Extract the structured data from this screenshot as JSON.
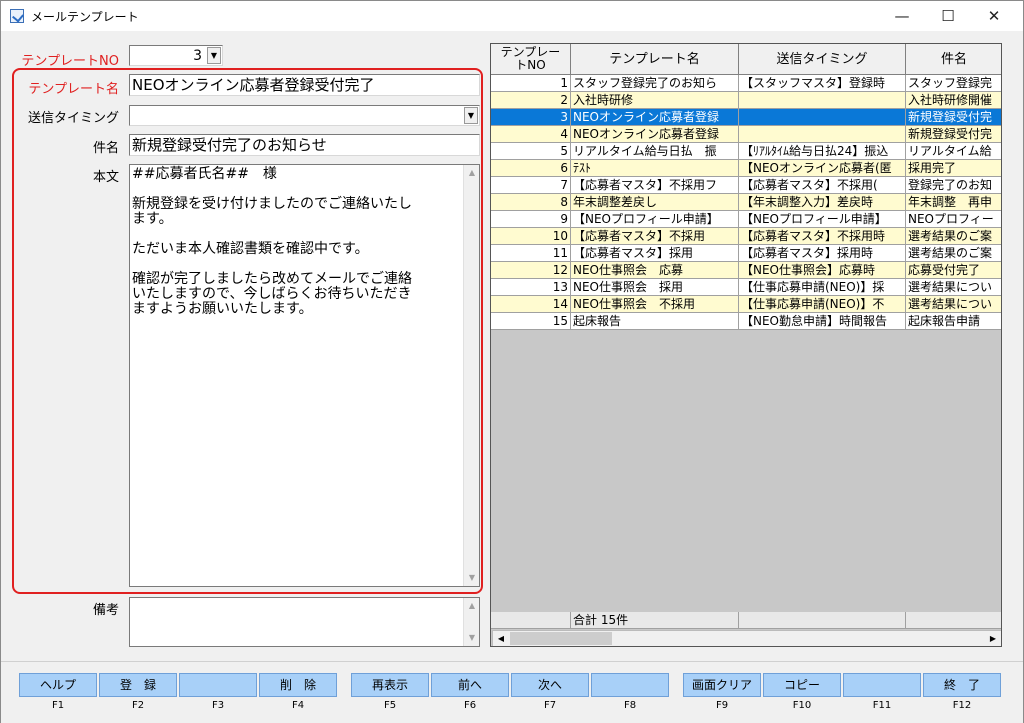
{
  "window": {
    "title": "メールテンプレート",
    "minimize": "—",
    "maximize": "☐",
    "close": "✕"
  },
  "form": {
    "template_no_label": "テンプレートNO",
    "template_no_value": "3",
    "template_name_label": "テンプレート名",
    "template_name_value": "NEOオンライン応募者登録受付完了",
    "timing_label": "送信タイミング",
    "timing_value": "",
    "subject_label": "件名",
    "subject_value": "新規登録受付完了のお知らせ",
    "body_label": "本文",
    "body_lines": [
      "##応募者氏名##　様",
      "",
      "新規登録を受け付けましたのでご連絡いたし",
      "ます。",
      "",
      "ただいま本人確認書類を確認中です。",
      "",
      "確認が完了しましたら改めてメールでご連絡",
      "いたしますので、今しばらくお待ちいただき",
      "ますようお願いいたします。"
    ],
    "remarks_label": "備考",
    "remarks_value": ""
  },
  "grid": {
    "headers": [
      "テンプレートNO",
      "テンプレート名",
      "送信タイミング",
      "件名"
    ],
    "header_no_line1": "テンプレー",
    "header_no_line2": "トNO",
    "rows": [
      {
        "no": "1",
        "name": "スタッフ登録完了のお知ら",
        "timing": "【スタッフマスタ】登録時",
        "subject": "スタッフ登録完"
      },
      {
        "no": "2",
        "name": "入社時研修",
        "timing": "",
        "subject": "入社時研修開催"
      },
      {
        "no": "3",
        "name": "NEOオンライン応募者登録",
        "timing": "",
        "subject": "新規登録受付完"
      },
      {
        "no": "4",
        "name": "NEOオンライン応募者登録",
        "timing": "",
        "subject": "新規登録受付完"
      },
      {
        "no": "5",
        "name": "リアルタイム給与日払　振",
        "timing": "【ﾘｱﾙﾀｲﾑ給与日払24】振込",
        "subject": "リアルタイム給"
      },
      {
        "no": "6",
        "name": "ﾃｽﾄ",
        "timing": "【NEOオンライン応募者(匿",
        "subject": "採用完了"
      },
      {
        "no": "7",
        "name": "【応募者マスタ】不採用フ",
        "timing": "【応募者マスタ】不採用(",
        "subject": "登録完了のお知"
      },
      {
        "no": "8",
        "name": "年末調整差戻し",
        "timing": "【年末調整入力】差戻時",
        "subject": "年末調整　再申"
      },
      {
        "no": "9",
        "name": "【NEOプロフィール申請】",
        "timing": "【NEOプロフィール申請】",
        "subject": "NEOプロフィー"
      },
      {
        "no": "10",
        "name": "【応募者マスタ】不採用",
        "timing": "【応募者マスタ】不採用時",
        "subject": "選考結果のご案"
      },
      {
        "no": "11",
        "name": "【応募者マスタ】採用",
        "timing": "【応募者マスタ】採用時",
        "subject": "選考結果のご案"
      },
      {
        "no": "12",
        "name": "NEO仕事照会　応募",
        "timing": "【NEO仕事照会】応募時",
        "subject": "応募受付完了"
      },
      {
        "no": "13",
        "name": "NEO仕事照会　採用",
        "timing": "【仕事応募申請(NEO)】採",
        "subject": "選考結果につい"
      },
      {
        "no": "14",
        "name": "NEO仕事照会　不採用",
        "timing": "【仕事応募申請(NEO)】不",
        "subject": "選考結果につい"
      },
      {
        "no": "15",
        "name": "起床報告",
        "timing": "【NEO勤怠申請】時間報告",
        "subject": "起床報告申請"
      }
    ],
    "selected_row": 3,
    "footer_total": "合計 15件",
    "colors": {
      "row_white": "#ffffff",
      "row_yellow": "#fffbd0",
      "selected": "#0a78d7"
    }
  },
  "fkeys": [
    {
      "label": "ヘルプ",
      "key": "F1"
    },
    {
      "label": "登　録",
      "key": "F2"
    },
    {
      "label": "",
      "key": "F3"
    },
    {
      "label": "削　除",
      "key": "F4"
    },
    {
      "label": "再表示",
      "key": "F5"
    },
    {
      "label": "前へ",
      "key": "F6"
    },
    {
      "label": "次へ",
      "key": "F7"
    },
    {
      "label": "",
      "key": "F8"
    },
    {
      "label": "画面クリア",
      "key": "F9"
    },
    {
      "label": "コピー",
      "key": "F10"
    },
    {
      "label": "",
      "key": "F11"
    },
    {
      "label": "終　了",
      "key": "F12"
    }
  ]
}
